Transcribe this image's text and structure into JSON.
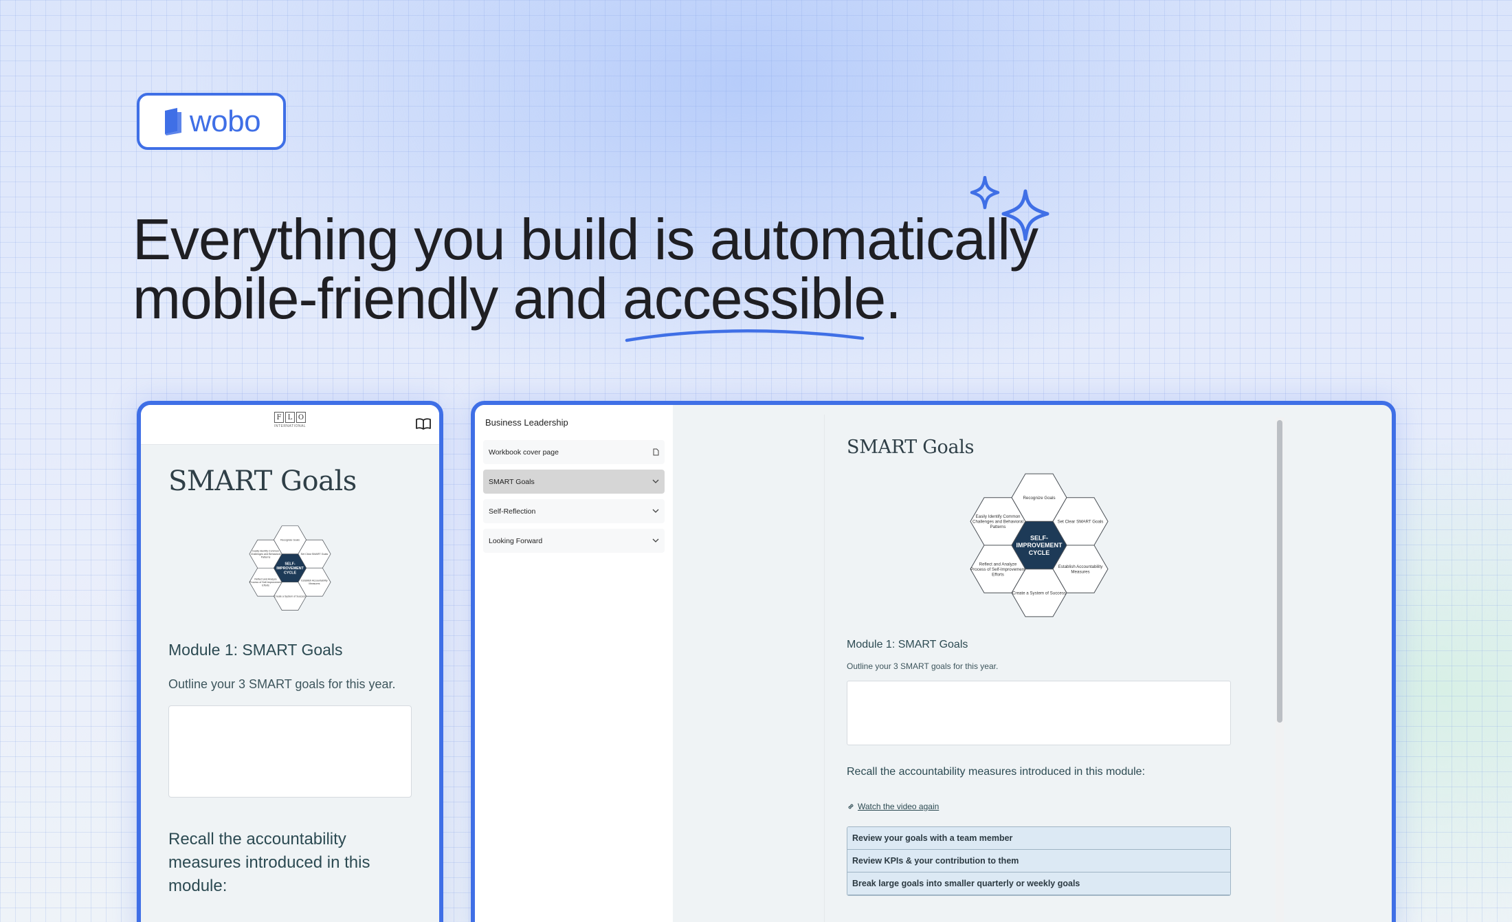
{
  "brand": {
    "name": "wobo",
    "color": "#3f6fe6"
  },
  "headline": {
    "line1": "Everything you build is automatically",
    "line2_prefix": "mobile-friendly and ",
    "accent_word": "accessible",
    "suffix": "."
  },
  "mobile": {
    "logo_letters": [
      "F",
      "L",
      "O"
    ],
    "logo_sub": "INTERNATIONAL",
    "title": "SMART Goals",
    "module_heading": "Module 1: SMART Goals",
    "outline_text": "Outline your 3 SMART goals for this year.",
    "recall_heading": "Recall the accountability measures introduced in this module:"
  },
  "desktop": {
    "sidebar_title": "Business Leadership",
    "sidebar_items": [
      {
        "label": "Workbook cover page",
        "icon": "page-icon"
      },
      {
        "label": "SMART Goals",
        "icon": "chevron-down-icon",
        "active": true
      },
      {
        "label": "Self-Reflection",
        "icon": "chevron-down-icon"
      },
      {
        "label": "Looking Forward",
        "icon": "chevron-down-icon"
      }
    ],
    "title": "SMART Goals",
    "module_heading": "Module 1: SMART Goals",
    "outline_text": "Outline your 3 SMART goals for this year.",
    "recall_heading": "Recall the accountability measures introduced in this module:",
    "video_link": "Watch the video again",
    "measures": [
      "Review your goals with a team member",
      "Review KPIs & your contribution to them",
      "Break large goals into smaller quarterly or weekly goals"
    ]
  },
  "diagram": {
    "center": [
      "SELF-",
      "IMPROVEMENT",
      "CYCLE"
    ],
    "cells": [
      [
        "Recognize Goals"
      ],
      [
        "Set Clear SMART Goals"
      ],
      [
        "Establish Accountability",
        "Measures"
      ],
      [
        "Create a System of Success"
      ],
      [
        "Reflect and Analyze",
        "Process of Self-Improvement",
        "Efforts"
      ],
      [
        "Easily Identify Common",
        "Challenges and Behavioral",
        "Patterns"
      ]
    ]
  }
}
